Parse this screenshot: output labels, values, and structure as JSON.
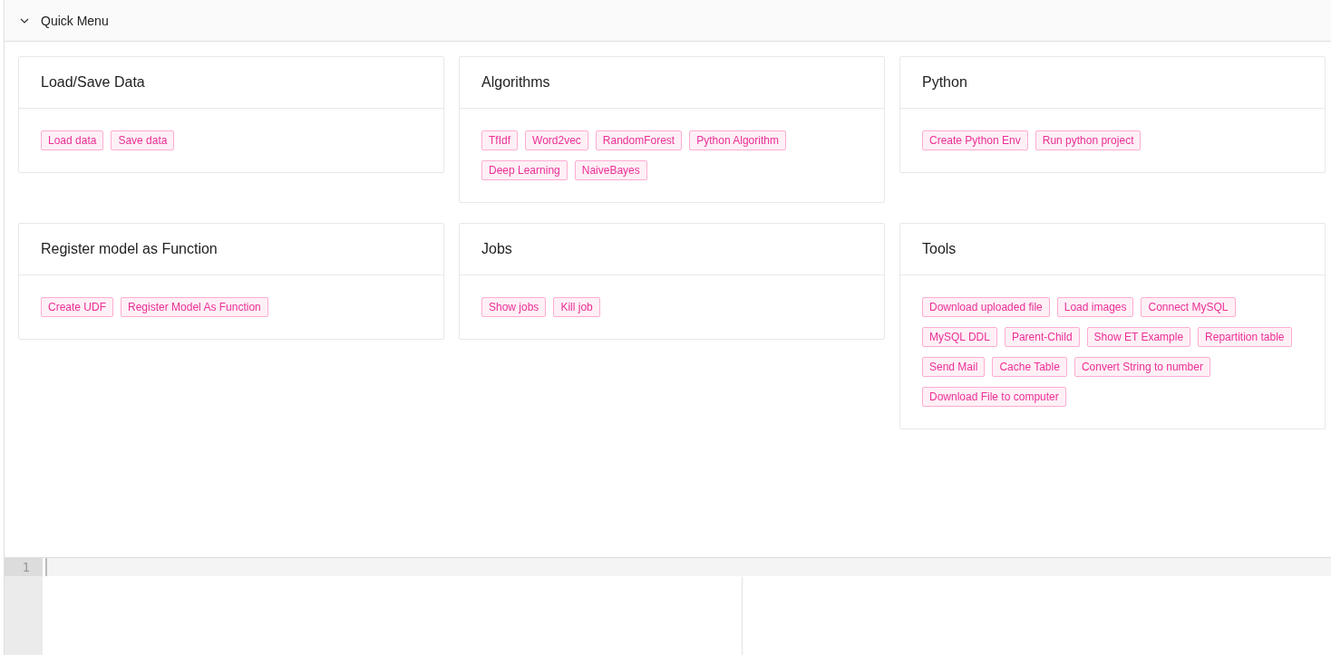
{
  "quick_menu": {
    "title": "Quick Menu",
    "expanded": true,
    "cards": [
      {
        "title": "Load/Save Data",
        "tags": [
          "Load data",
          "Save data"
        ]
      },
      {
        "title": "Algorithms",
        "tags": [
          "TfIdf",
          "Word2vec",
          "RandomForest",
          "Python Algorithm",
          "Deep Learning",
          "NaiveBayes"
        ]
      },
      {
        "title": "Python",
        "tags": [
          "Create Python Env",
          "Run python project"
        ]
      },
      {
        "title": "Register model as Function",
        "tags": [
          "Create UDF",
          "Register Model As Function"
        ]
      },
      {
        "title": "Jobs",
        "tags": [
          "Show jobs",
          "Kill job"
        ]
      },
      {
        "title": "Tools",
        "tags": [
          "Download uploaded file",
          "Load images",
          "Connect MySQL",
          "MySQL DDL",
          "Parent-Child",
          "Show ET Example",
          "Repartition table",
          "Send Mail",
          "Cache Table",
          "Convert String to number",
          "Download File to computer"
        ]
      }
    ]
  },
  "editor": {
    "line_numbers": [
      "1"
    ]
  }
}
